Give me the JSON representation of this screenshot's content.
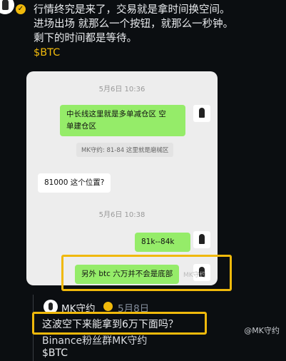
{
  "post": {
    "lines": [
      "行情终究是来了，交易就是拿时间换空间。",
      "进场出场 就那么一个按钮，就那么一秒钟。",
      "剩下的时间都是等待。"
    ],
    "cashtag": "$BTC"
  },
  "chat": {
    "timestamp_1": "5月6日 10:36",
    "msg_1_line_1": "中长线这里就是多单减仓区  空",
    "msg_1_line_2": "单建仓区",
    "quote_1": "MK守约: 81-84 这里就是磨械区",
    "msg_2": "81000 这个位置?",
    "timestamp_2": "5月6日 10:38",
    "msg_3": "81k--84k",
    "msg_4": "另外 btc 六万并不会是底部",
    "watermark_inner": "MK守约"
  },
  "quoted_post": {
    "author": "MK守约",
    "author_badge": "🎖",
    "date": "5月8日",
    "line_1": "这波空下来能拿到6万下面吗？",
    "line_2": "Binance粉丝群MK守约",
    "cashtag": "$BTC"
  },
  "watermark": "@MK守约",
  "highlight_color": "#f0b90b"
}
